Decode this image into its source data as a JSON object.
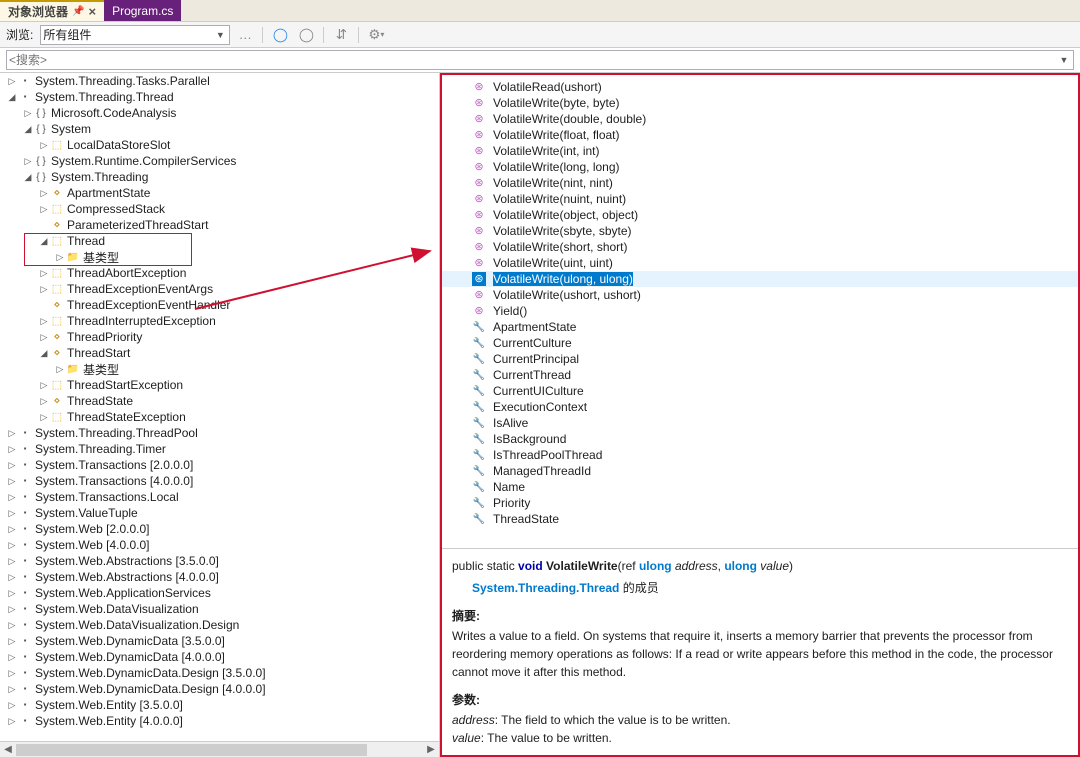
{
  "tabs": {
    "active": "对象浏览器",
    "inactive": "Program.cs"
  },
  "toolbar": {
    "browseLabel": "浏览:",
    "scope": "所有组件"
  },
  "search": {
    "placeholder": "<搜索>"
  },
  "tree": [
    {
      "l": 0,
      "e": "▷",
      "ic": "asm",
      "t": "System.Threading.Tasks.Parallel",
      "asm": true
    },
    {
      "l": 0,
      "e": "◢",
      "ic": "asm",
      "t": "System.Threading.Thread",
      "asm": true
    },
    {
      "l": 1,
      "e": "▷",
      "ic": "ns",
      "t": "Microsoft.CodeAnalysis"
    },
    {
      "l": 1,
      "e": "◢",
      "ic": "ns",
      "t": "System"
    },
    {
      "l": 2,
      "e": "▷",
      "ic": "class",
      "t": "LocalDataStoreSlot"
    },
    {
      "l": 1,
      "e": "▷",
      "ic": "ns",
      "t": "System.Runtime.CompilerServices"
    },
    {
      "l": 1,
      "e": "◢",
      "ic": "ns",
      "t": "System.Threading"
    },
    {
      "l": 2,
      "e": "▷",
      "ic": "delegate",
      "t": "ApartmentState"
    },
    {
      "l": 2,
      "e": "▷",
      "ic": "class",
      "t": "CompressedStack"
    },
    {
      "l": 2,
      "e": "",
      "ic": "delegate",
      "t": "ParameterizedThreadStart"
    },
    {
      "l": 2,
      "e": "◢",
      "ic": "class",
      "t": "Thread"
    },
    {
      "l": 3,
      "e": "▷",
      "ic": "folder",
      "t": "基类型"
    },
    {
      "l": 2,
      "e": "▷",
      "ic": "class",
      "t": "ThreadAbortException"
    },
    {
      "l": 2,
      "e": "▷",
      "ic": "class",
      "t": "ThreadExceptionEventArgs"
    },
    {
      "l": 2,
      "e": "",
      "ic": "delegate",
      "t": "ThreadExceptionEventHandler"
    },
    {
      "l": 2,
      "e": "▷",
      "ic": "class",
      "t": "ThreadInterruptedException"
    },
    {
      "l": 2,
      "e": "▷",
      "ic": "delegate",
      "t": "ThreadPriority"
    },
    {
      "l": 2,
      "e": "◢",
      "ic": "delegate",
      "t": "ThreadStart"
    },
    {
      "l": 3,
      "e": "▷",
      "ic": "folder",
      "t": "基类型"
    },
    {
      "l": 2,
      "e": "▷",
      "ic": "class",
      "t": "ThreadStartException"
    },
    {
      "l": 2,
      "e": "▷",
      "ic": "delegate",
      "t": "ThreadState"
    },
    {
      "l": 2,
      "e": "▷",
      "ic": "class",
      "t": "ThreadStateException"
    },
    {
      "l": 0,
      "e": "▷",
      "ic": "asm",
      "t": "System.Threading.ThreadPool",
      "asm": true
    },
    {
      "l": 0,
      "e": "▷",
      "ic": "asm",
      "t": "System.Threading.Timer",
      "asm": true
    },
    {
      "l": 0,
      "e": "▷",
      "ic": "asm",
      "t": "System.Transactions [2.0.0.0]",
      "asm": true
    },
    {
      "l": 0,
      "e": "▷",
      "ic": "asm",
      "t": "System.Transactions [4.0.0.0]",
      "asm": true
    },
    {
      "l": 0,
      "e": "▷",
      "ic": "asm",
      "t": "System.Transactions.Local",
      "asm": true
    },
    {
      "l": 0,
      "e": "▷",
      "ic": "asm",
      "t": "System.ValueTuple",
      "asm": true
    },
    {
      "l": 0,
      "e": "▷",
      "ic": "asm",
      "t": "System.Web [2.0.0.0]",
      "asm": true
    },
    {
      "l": 0,
      "e": "▷",
      "ic": "asm",
      "t": "System.Web [4.0.0.0]",
      "asm": true
    },
    {
      "l": 0,
      "e": "▷",
      "ic": "asm",
      "t": "System.Web.Abstractions [3.5.0.0]",
      "asm": true
    },
    {
      "l": 0,
      "e": "▷",
      "ic": "asm",
      "t": "System.Web.Abstractions [4.0.0.0]",
      "asm": true
    },
    {
      "l": 0,
      "e": "▷",
      "ic": "asm",
      "t": "System.Web.ApplicationServices",
      "asm": true
    },
    {
      "l": 0,
      "e": "▷",
      "ic": "asm",
      "t": "System.Web.DataVisualization",
      "asm": true
    },
    {
      "l": 0,
      "e": "▷",
      "ic": "asm",
      "t": "System.Web.DataVisualization.Design",
      "asm": true
    },
    {
      "l": 0,
      "e": "▷",
      "ic": "asm",
      "t": "System.Web.DynamicData [3.5.0.0]",
      "asm": true
    },
    {
      "l": 0,
      "e": "▷",
      "ic": "asm",
      "t": "System.Web.DynamicData [4.0.0.0]",
      "asm": true
    },
    {
      "l": 0,
      "e": "▷",
      "ic": "asm",
      "t": "System.Web.DynamicData.Design [3.5.0.0]",
      "asm": true
    },
    {
      "l": 0,
      "e": "▷",
      "ic": "asm",
      "t": "System.Web.DynamicData.Design [4.0.0.0]",
      "asm": true
    },
    {
      "l": 0,
      "e": "▷",
      "ic": "asm",
      "t": "System.Web.Entity [3.5.0.0]",
      "asm": true
    },
    {
      "l": 0,
      "e": "▷",
      "ic": "asm",
      "t": "System.Web.Entity [4.0.0.0]",
      "asm": true
    }
  ],
  "members": [
    {
      "ic": "method",
      "t": "VolatileRead(ushort)"
    },
    {
      "ic": "method",
      "t": "VolatileWrite(byte, byte)"
    },
    {
      "ic": "method",
      "t": "VolatileWrite(double, double)"
    },
    {
      "ic": "method",
      "t": "VolatileWrite(float, float)"
    },
    {
      "ic": "method",
      "t": "VolatileWrite(int, int)"
    },
    {
      "ic": "method",
      "t": "VolatileWrite(long, long)"
    },
    {
      "ic": "method",
      "t": "VolatileWrite(nint, nint)"
    },
    {
      "ic": "method",
      "t": "VolatileWrite(nuint, nuint)"
    },
    {
      "ic": "method",
      "t": "VolatileWrite(object, object)"
    },
    {
      "ic": "method",
      "t": "VolatileWrite(sbyte, sbyte)"
    },
    {
      "ic": "method",
      "t": "VolatileWrite(short, short)"
    },
    {
      "ic": "method",
      "t": "VolatileWrite(uint, uint)"
    },
    {
      "ic": "method",
      "t": "VolatileWrite(ulong, ulong)",
      "sel": true
    },
    {
      "ic": "method",
      "t": "VolatileWrite(ushort, ushort)"
    },
    {
      "ic": "method",
      "t": "Yield()"
    },
    {
      "ic": "prop",
      "t": "ApartmentState"
    },
    {
      "ic": "prop",
      "t": "CurrentCulture"
    },
    {
      "ic": "prop",
      "t": "CurrentPrincipal"
    },
    {
      "ic": "prop",
      "t": "CurrentThread"
    },
    {
      "ic": "prop",
      "t": "CurrentUICulture"
    },
    {
      "ic": "prop",
      "t": "ExecutionContext"
    },
    {
      "ic": "prop",
      "t": "IsAlive"
    },
    {
      "ic": "prop",
      "t": "IsBackground"
    },
    {
      "ic": "prop",
      "t": "IsThreadPoolThread"
    },
    {
      "ic": "prop",
      "t": "ManagedThreadId"
    },
    {
      "ic": "prop",
      "t": "Name"
    },
    {
      "ic": "prop",
      "t": "Priority"
    },
    {
      "ic": "prop",
      "t": "ThreadState"
    }
  ],
  "summary": {
    "sigPre": "public static ",
    "kwVoid": "void",
    "method": " VolatileWrite",
    "open": "(ref ",
    "kwUlong1": "ulong",
    "arg1": " address",
    "comma": ", ",
    "kwUlong2": "ulong",
    "arg2": " value",
    "close": ")",
    "owner": "System.Threading.Thread",
    "ownerSuffix": " 的成员",
    "hSummary": "摘要:",
    "summaryText": "Writes a value to a field. On systems that require it, inserts a memory barrier that prevents the processor from reordering memory operations as follows: If a read or write appears before this method in the code, the processor cannot move it after this method.",
    "hParams": "参数:",
    "p1name": "address",
    "p1desc": ": The field to which the value is to be written.",
    "p2name": "value",
    "p2desc": ": The value to be written."
  }
}
